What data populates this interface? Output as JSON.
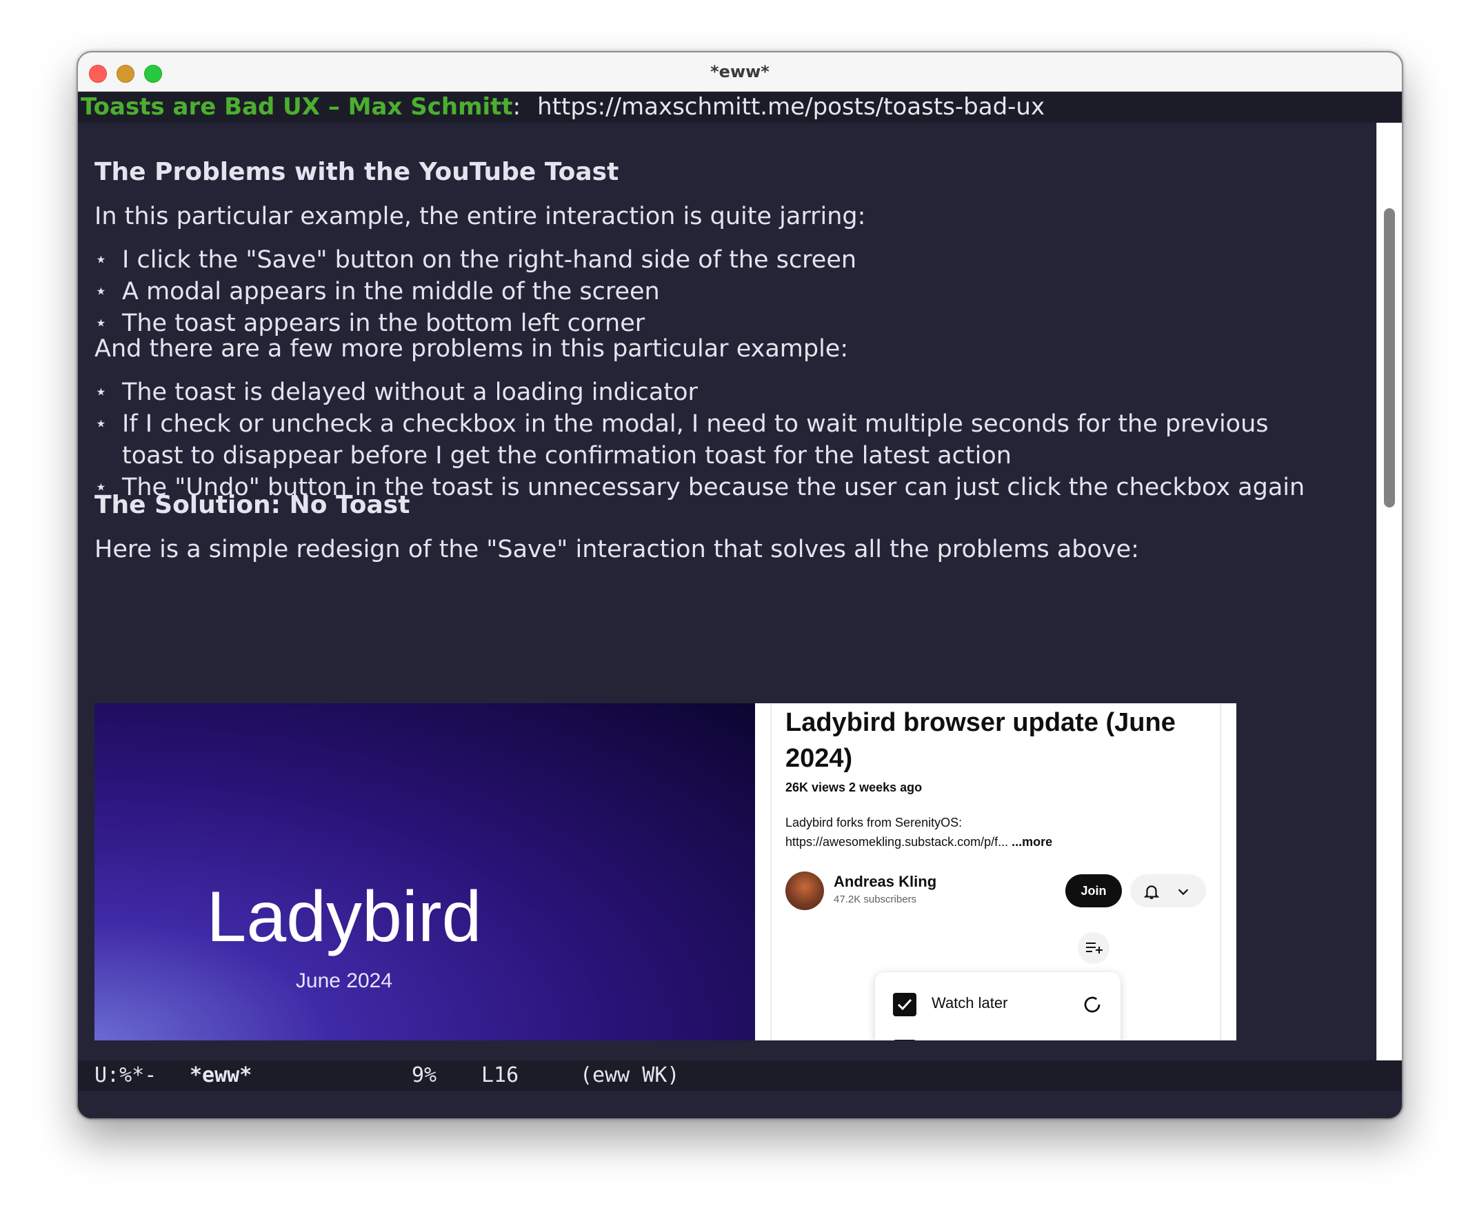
{
  "window": {
    "title": "*eww*"
  },
  "header": {
    "doc_title": "Toasts are Bad UX – Max Schmitt",
    "separator": ":",
    "url": "https://maxschmitt.me/posts/toasts-bad-ux"
  },
  "content": {
    "heading1": "The Problems with the YouTube Toast",
    "para1": "In this particular example, the entire interaction is quite jarring:",
    "bullet_symbol": "⋆",
    "list1": [
      "I click the \"Save\" button on the right-hand side of the screen",
      "A modal appears in the middle of the screen",
      "The toast appears in the bottom left corner"
    ],
    "para2": "And there are a few more problems in this particular example:",
    "list2": [
      "The toast is delayed without a loading indicator",
      "If I check or uncheck a checkbox in the modal, I need to wait multiple seconds for the previous",
      "toast to disappear before I get the confirmation toast for the latest action",
      "The \"Undo\" button in the toast is unnecessary because the user can just click the checkbox again"
    ],
    "heading2": "The Solution: No Toast",
    "para3": "Here is a simple redesign of the \"Save\" interaction that solves all the problems above:"
  },
  "image": {
    "brand": "Ladybird",
    "brand_sub": "June 2024",
    "video_title": "Ladybird browser update (June 2024)",
    "meta": "26K views  2 weeks ago",
    "desc_line1": "Ladybird forks from SerenityOS:",
    "desc_line2": "https://awesomekling.substack.com/p/f...",
    "desc_more": "...more",
    "channel": "Andreas Kling",
    "subscribers": "47.2K subscribers",
    "join": "Join",
    "watch_later": "Watch later"
  },
  "modeline": {
    "status": "U:%*-",
    "buffer": "*eww*",
    "percent": "9%",
    "line": "L16",
    "mode": "(eww WK)"
  }
}
